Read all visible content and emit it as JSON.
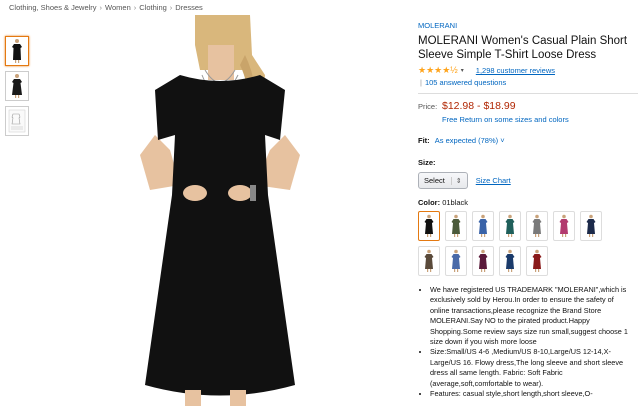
{
  "breadcrumb": [
    "Clothing, Shoes & Jewelry",
    "Women",
    "Clothing",
    "Dresses"
  ],
  "breadcrumb_separator": "›",
  "thumbnails": [
    {
      "name": "thumb-front",
      "color": "#111111"
    },
    {
      "name": "thumb-side",
      "color": "#1a1a1a"
    },
    {
      "name": "thumb-size-chart",
      "color": "#dddddd"
    }
  ],
  "product": {
    "brand": "MOLERANI",
    "title": "MOLERANI Women's Casual Plain Short Sleeve Simple T-Shirt Loose Dress",
    "stars": "★★★★½",
    "reviews": "1,298 customer reviews",
    "answered": "105 answered questions",
    "price_label": "Price:",
    "price": "$12.98 - $18.99",
    "free_return": "Free Return on some sizes and colors",
    "fit_label": "Fit:",
    "fit_value": "As expected (78%)",
    "fit_caret": "˅",
    "size_label": "Size:",
    "size_select": "Select",
    "size_caret": "⇕",
    "size_chart": "Size Chart",
    "color_label": "Color:",
    "color_value": "01black"
  },
  "swatches": [
    "#111111",
    "#4b5a3a",
    "#3a63a8",
    "#1f5f5a",
    "#7a7a7a",
    "#b23a6e",
    "#1c2a4a",
    "#5a4a3a",
    "#4a6aa8",
    "#5a1a3a",
    "#1a3a6a",
    "#8a1a1a"
  ],
  "colors": {
    "accent": "#e47911",
    "link": "#0066c0",
    "price": "#b12704",
    "star": "#ffa41c"
  },
  "bullets": [
    "We have registered US TRADEMARK \"MOLERANI\",which is exclusively sold by Herou.In order to ensure the safety of online transactions,please recognize the Brand Store MOLERANI.Say NO to the pirated product.Happy Shopping.Some review says size run small,suggest choose 1 size down if you wish more loose",
    "Size:Small/US 4-6 ,Medium/US 8-10,Large/US 12-14,X-Large/US 16. Flowy dress,The long sleeve and short sleeve dress all same length. Fabric: Soft Fabric (average,soft,comfortable to wear).",
    "Features: casual style,short length,short sleeve,O-"
  ]
}
